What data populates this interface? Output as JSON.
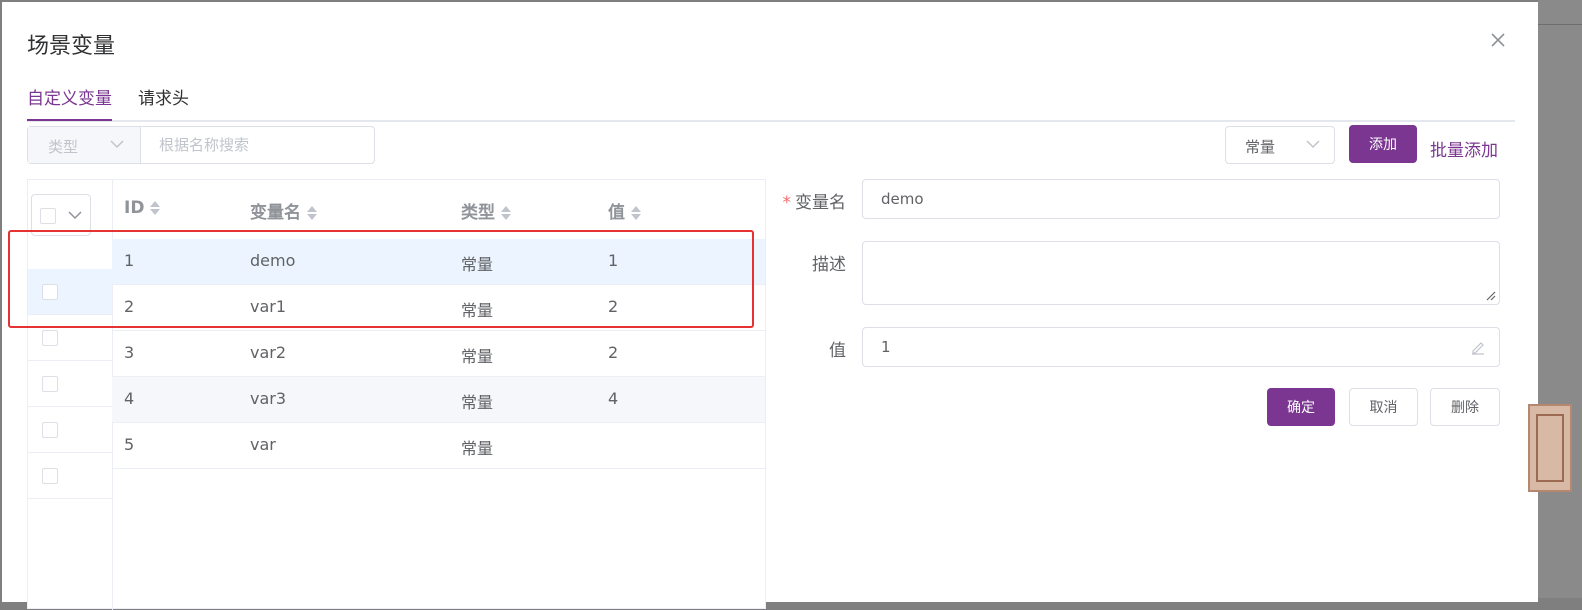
{
  "dialog": {
    "title": "场景变量",
    "tabs": [
      {
        "label": "自定义变量",
        "active": true
      },
      {
        "label": "请求头",
        "active": false
      }
    ]
  },
  "filter": {
    "type_placeholder": "类型",
    "search_placeholder": "根据名称搜索"
  },
  "toolbar": {
    "kind_selected": "常量",
    "add_label": "添加",
    "batch_add_label": "批量添加"
  },
  "table": {
    "columns": [
      "ID",
      "变量名",
      "类型",
      "值"
    ],
    "rows": [
      {
        "id": "1",
        "name": "demo",
        "type": "常量",
        "value": "1"
      },
      {
        "id": "2",
        "name": "var1",
        "type": "常量",
        "value": "2"
      },
      {
        "id": "3",
        "name": "var2",
        "type": "常量",
        "value": "2"
      },
      {
        "id": "4",
        "name": "var3",
        "type": "常量",
        "value": "4"
      },
      {
        "id": "5",
        "name": "var",
        "type": "常量",
        "value": ""
      }
    ]
  },
  "form": {
    "name_label": "变量名",
    "required_mark": "*",
    "name_value": "demo",
    "desc_label": "描述",
    "desc_value": "",
    "value_label": "值",
    "value_value": "1",
    "confirm_label": "确定",
    "cancel_label": "取消",
    "delete_label": "删除"
  },
  "colors": {
    "primary": "#7b3691",
    "highlight": "#e53333",
    "selected_row": "#ecf5ff"
  },
  "icons": [
    "close-icon",
    "chevron-down-icon",
    "sort-icon",
    "edit-icon",
    "resize-icon",
    "checkbox-icon"
  ]
}
